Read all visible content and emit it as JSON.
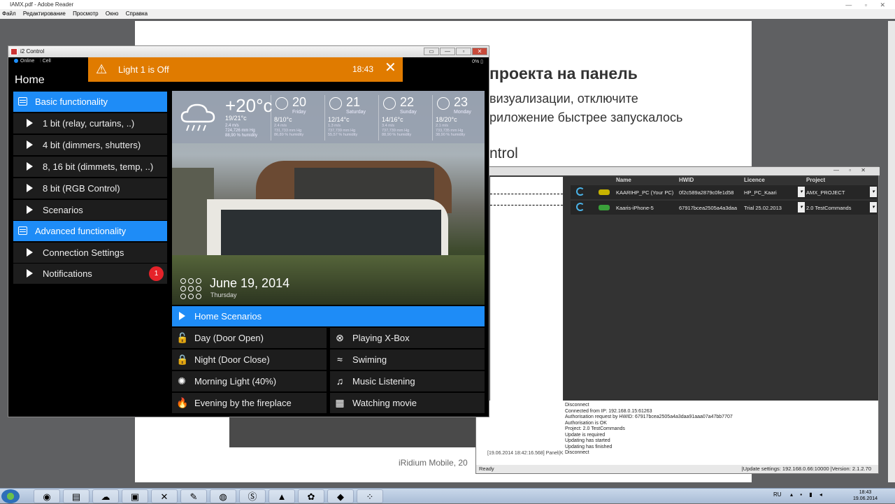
{
  "reader": {
    "title": "IAMX.pdf - Adobe Reader",
    "menu": [
      "Файл",
      "Редактирование",
      "Просмотр",
      "Окно",
      "Справка"
    ],
    "heading": "проекта на панель",
    "para1": "визуализации, отключите",
    "para2": "риложение быстрее запускалось",
    "para3": "ntrol",
    "footer": "iRidium Mobile, 20"
  },
  "server": {
    "columns": [
      "Name",
      "HWID",
      "Licence",
      "Project"
    ],
    "rows": [
      {
        "name": "KAARIHP_PC (Your PC)",
        "hwid": "0f2c589a2879c0fe1d58",
        "licence": "HP_PC_Kaari",
        "project": "AMX_PROJECT",
        "pill_color": "#c8b400"
      },
      {
        "name": "Kaaris-iPhone-5",
        "hwid": "67917bcea2505a4a3daa",
        "licence": "Trial 25.02.2013",
        "project": "2.0 TestCommands",
        "pill_color": "#3aa03a"
      }
    ],
    "log": [
      "Disconnect",
      "Connected from IP: 192.168.0.15:61263",
      "Authorisation request by HWID: 67917bcea2505a4a3daa91aaa07a47bb7707",
      "Authorisation is OK",
      "Project: 2.0 TestCommands",
      "Update is required",
      "Updating has started",
      "Updating has finished",
      "Disconnect"
    ],
    "log_left": "[19.06.2014 18:42:16.568]    Panel(K",
    "status_left": "Ready",
    "status_right": "|Update settings: 192.168.0.66:10000  |Version: 2.1.2.70"
  },
  "i2": {
    "title": "i2 Control",
    "online": "Online",
    "cell": "Cell",
    "battery": "0%",
    "home": "Home",
    "notification": {
      "text": "Light 1 is Off",
      "time": "18:43"
    },
    "menu": [
      {
        "label": "Basic functionality",
        "selected": true,
        "icon": "database-icon"
      },
      {
        "label": "1 bit (relay, curtains, ..)"
      },
      {
        "label": "4 bit (dimmers, shutters)"
      },
      {
        "label": "8, 16 bit (dimmets, temp, ..)"
      },
      {
        "label": "8 bit (RGB Control)"
      },
      {
        "label": "Scenarios"
      },
      {
        "label": "Advanced functionality",
        "selected": true,
        "icon": "database-icon"
      },
      {
        "label": "Connection Settings"
      },
      {
        "label": "Notifications",
        "badge": "1"
      }
    ],
    "weather": {
      "now_temp": "+20°c",
      "now_range": "19/21°c",
      "now_details": [
        "2.4 m/s",
        "724,726 mm Hg",
        "88,90 % humidity"
      ],
      "forecast": [
        {
          "num": "20",
          "day": "Friday",
          "range": "8/10°c",
          "details": [
            "2.4 m/s",
            "731,733 mm Hg",
            "86,89 % humidity"
          ]
        },
        {
          "num": "21",
          "day": "Saturday",
          "range": "12/14°c",
          "details": [
            "1.3 m/s",
            "737,739 mm Hg",
            "55,57 % humidity"
          ]
        },
        {
          "num": "22",
          "day": "Sunday",
          "range": "14/16°c",
          "details": [
            "3.4 m/s",
            "737,739 mm Hg",
            "88,90 % humidity"
          ]
        },
        {
          "num": "23",
          "day": "Monday",
          "range": "18/20°c",
          "details": [
            "2.1 m/s",
            "733,735 mm Hg",
            "38,90 % humidity"
          ]
        }
      ]
    },
    "date": {
      "text": "June 19, 2014",
      "day": "Thursday"
    },
    "scenarios_header": "Home Scenarios",
    "scenarios": [
      {
        "label": "Day (Door Open)",
        "icon": "unlock-icon",
        "glyph": "🔓"
      },
      {
        "label": "Playing X-Box",
        "icon": "xbox-icon",
        "glyph": "⊗"
      },
      {
        "label": "Night (Door Close)",
        "icon": "lock-icon",
        "glyph": "🔒"
      },
      {
        "label": "Swiming",
        "icon": "swim-icon",
        "glyph": "≈"
      },
      {
        "label": "Morning Light (40%)",
        "icon": "sun-icon",
        "glyph": "✺"
      },
      {
        "label": "Music Listening",
        "icon": "guitar-icon",
        "glyph": "♫"
      },
      {
        "label": "Evening by the fireplace",
        "icon": "flame-icon",
        "glyph": "🔥"
      },
      {
        "label": "Watching movie",
        "icon": "film-icon",
        "glyph": "▦"
      }
    ]
  },
  "taskbar": {
    "lang": "RU",
    "time": "18:43",
    "date": "19.06.2014"
  }
}
